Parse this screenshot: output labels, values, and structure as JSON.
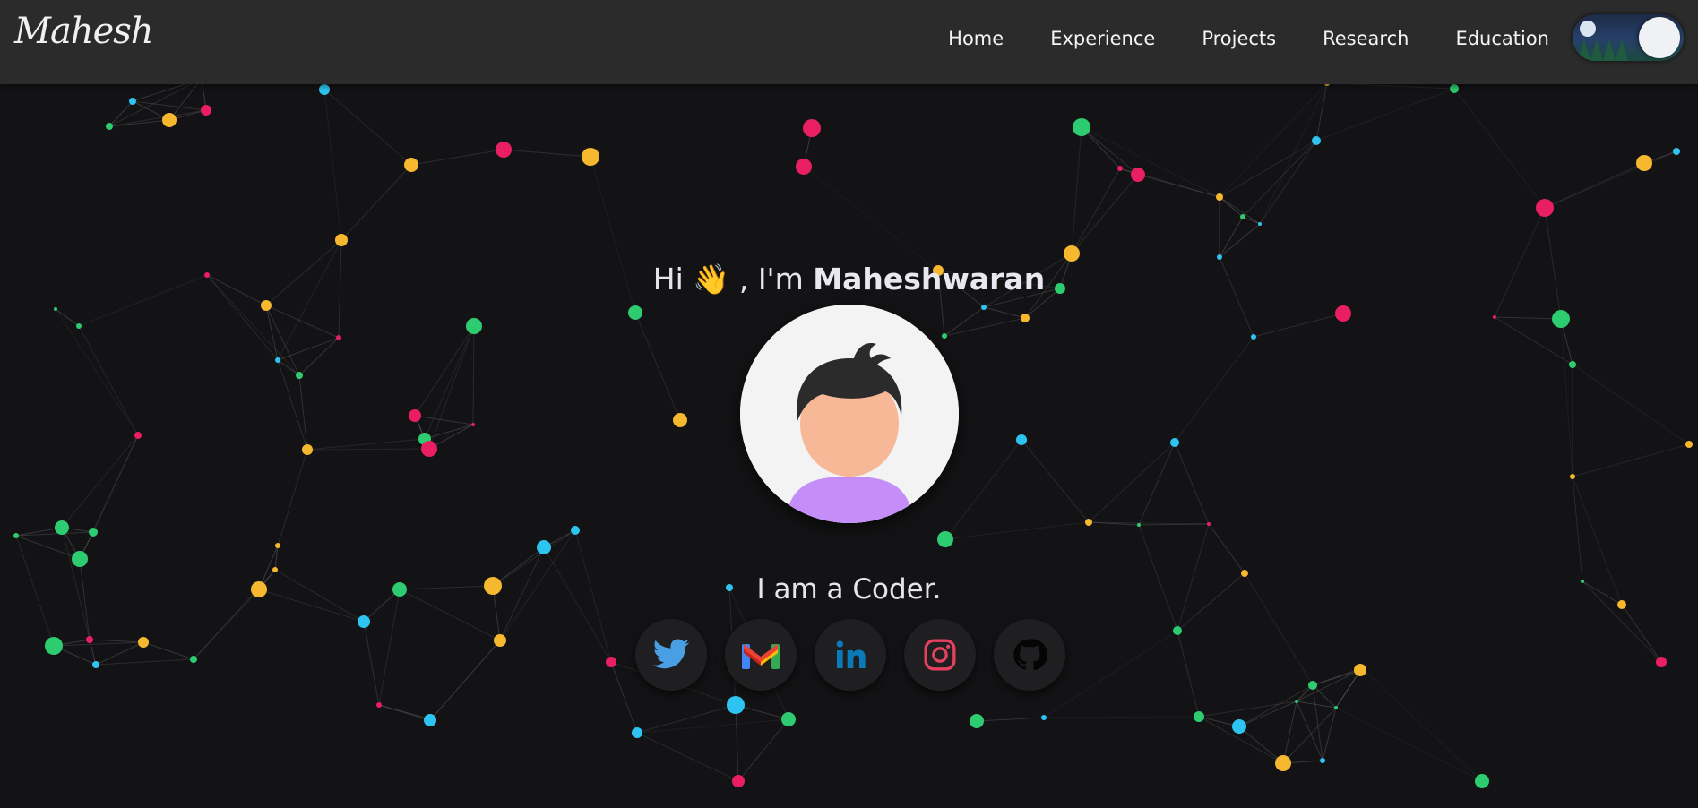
{
  "navbar": {
    "brand": "Mahesh",
    "links": [
      {
        "label": "Home"
      },
      {
        "label": "Experience"
      },
      {
        "label": "Projects"
      },
      {
        "label": "Research"
      },
      {
        "label": "Education"
      }
    ],
    "theme_toggle": {
      "state": "dark"
    }
  },
  "hero": {
    "greeting_prefix": "Hi ",
    "wave_emoji": "👋",
    "greeting_middle": " , I'm ",
    "name": "Maheshwaran",
    "tagline": "I am a Coder.",
    "avatar": {
      "icon": "avatar-icon"
    }
  },
  "socials": [
    {
      "name": "twitter",
      "icon": "twitter-icon",
      "color": "#4a9fe4"
    },
    {
      "name": "gmail",
      "icon": "gmail-icon",
      "color": "#ea4335"
    },
    {
      "name": "linkedin",
      "icon": "linkedin-icon",
      "color": "#0a7ab8"
    },
    {
      "name": "instagram",
      "icon": "instagram-icon",
      "color": "#e4405f"
    },
    {
      "name": "github",
      "icon": "github-icon",
      "color": "#000000"
    }
  ],
  "background": {
    "node_colors": [
      "#2ecc71",
      "#e91e63",
      "#f5b82e",
      "#2ec4f1"
    ],
    "background_color": "#131315"
  }
}
